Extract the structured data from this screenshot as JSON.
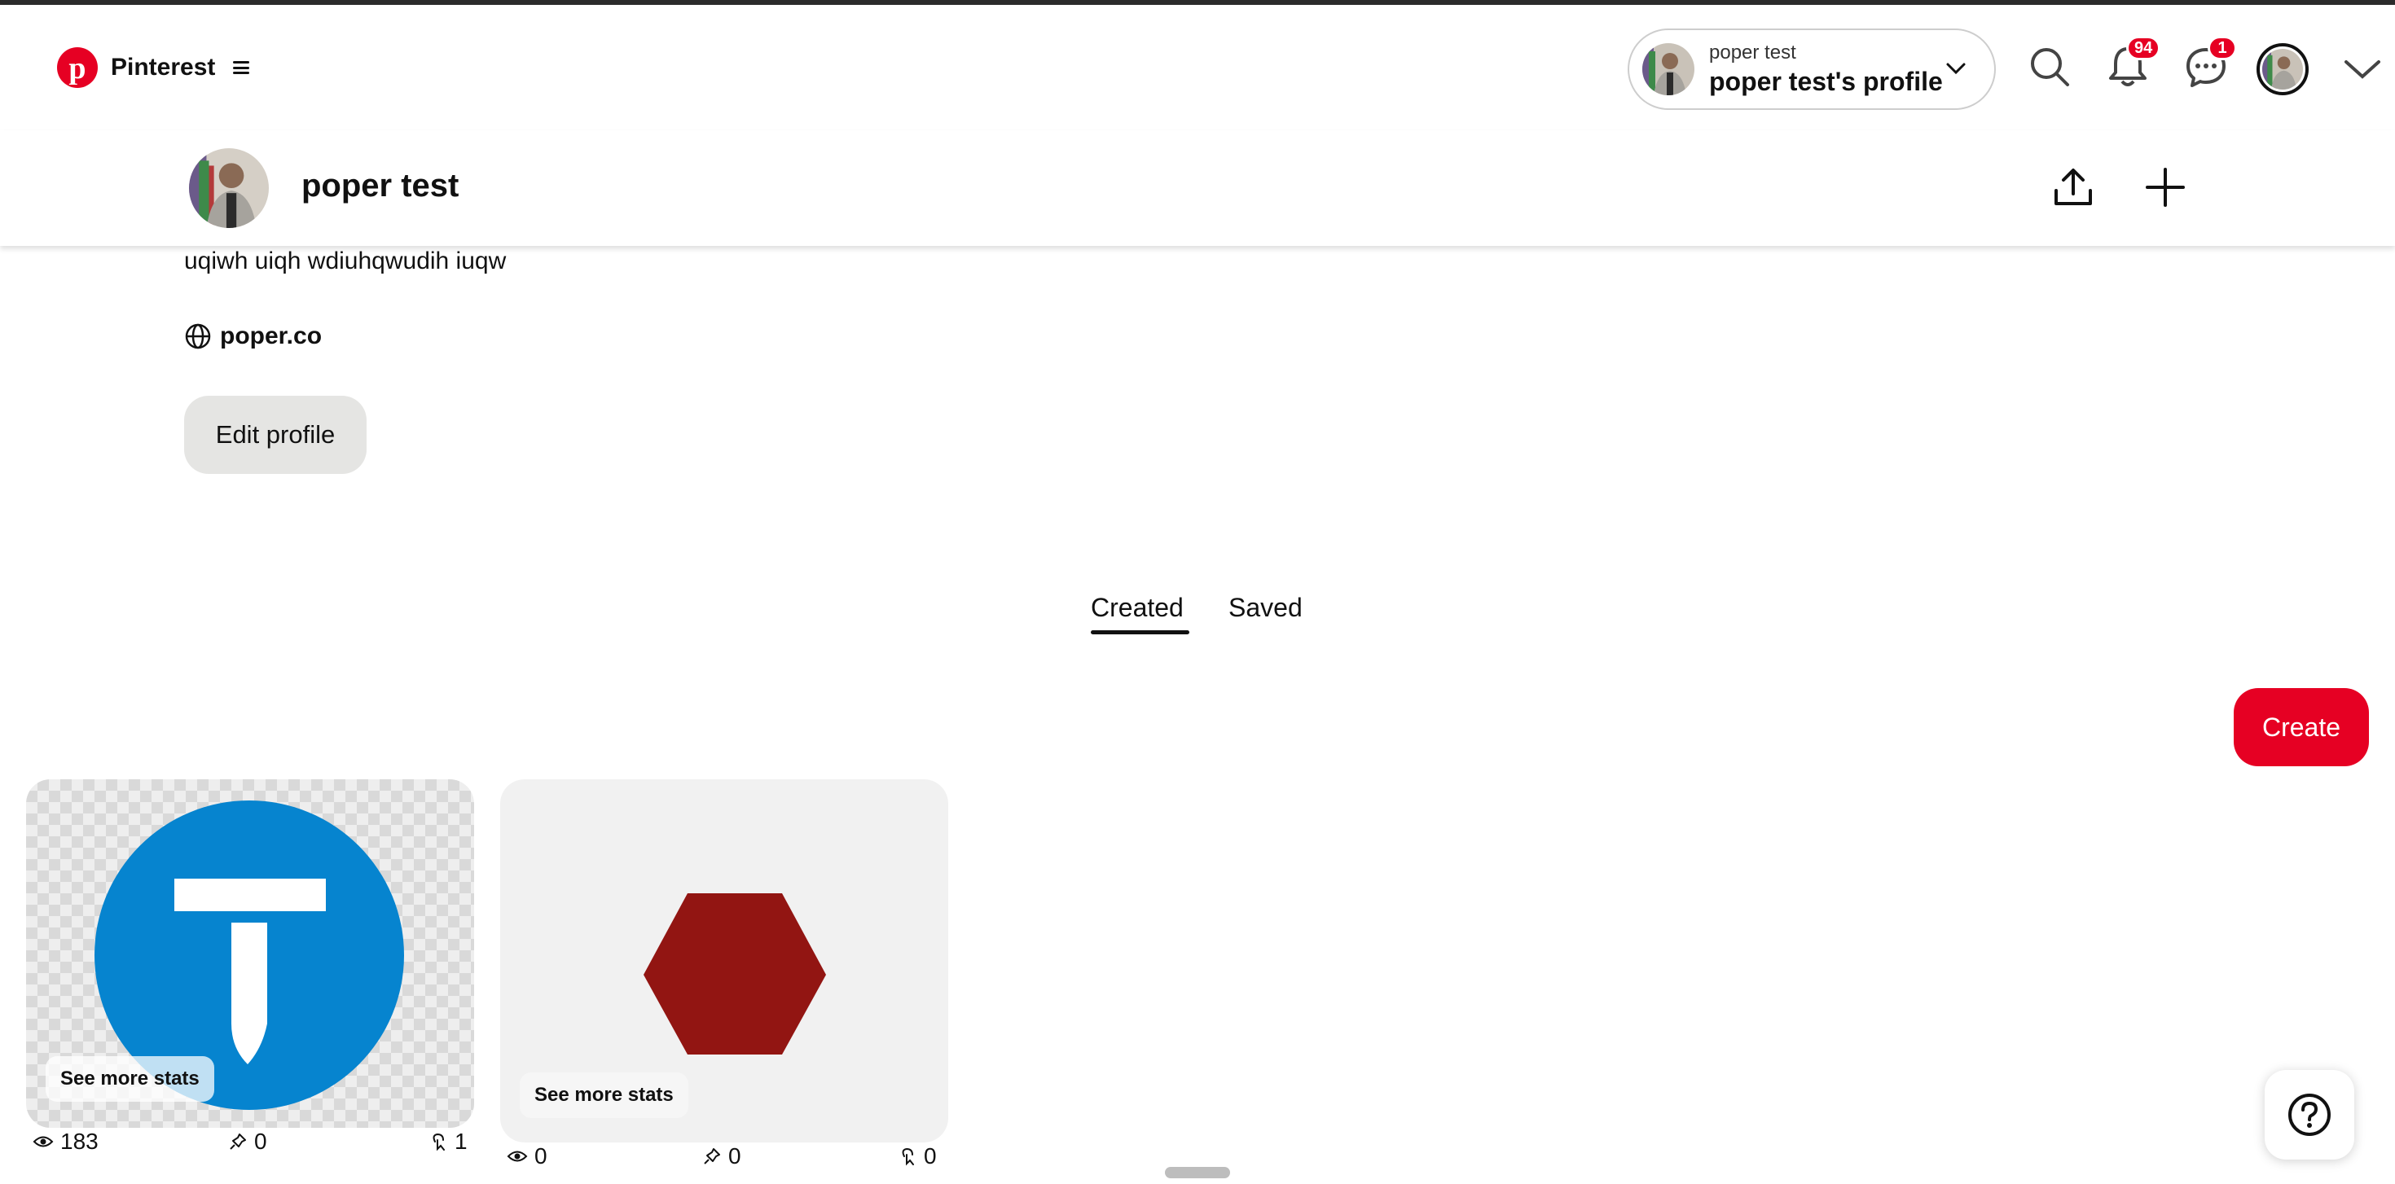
{
  "header": {
    "brand": "Pinterest",
    "profile_switch": {
      "name": "poper test",
      "label": "poper test's profile"
    },
    "notifications_count": "94",
    "messages_count": "1",
    "icons": [
      "pinterest-logo-icon",
      "menu-icon",
      "search-icon",
      "bell-icon",
      "messages-icon",
      "chevron-down-icon"
    ]
  },
  "sticky_profile": {
    "name": "poper test",
    "icons": [
      "share-icon",
      "plus-icon"
    ]
  },
  "profile": {
    "bio": "uqiwh uiqh wdiuhqwudih iuqw",
    "website": "poper.co",
    "edit_label": "Edit profile"
  },
  "tabs": [
    {
      "label": "Created",
      "active": true
    },
    {
      "label": "Saved",
      "active": false
    }
  ],
  "create_label": "Create",
  "pins": [
    {
      "stats_label": "See more stats",
      "views": "183",
      "saves": "0",
      "clicks": "1",
      "image": "blue circle T logo"
    },
    {
      "stats_label": "See more stats",
      "views": "0",
      "saves": "0",
      "clicks": "0",
      "image": "red hexagon"
    }
  ],
  "colors": {
    "brand_red": "#e60023",
    "logo_blue": "#0684cf",
    "hexagon_red": "#921512",
    "button_gray": "#e5e5e3"
  }
}
